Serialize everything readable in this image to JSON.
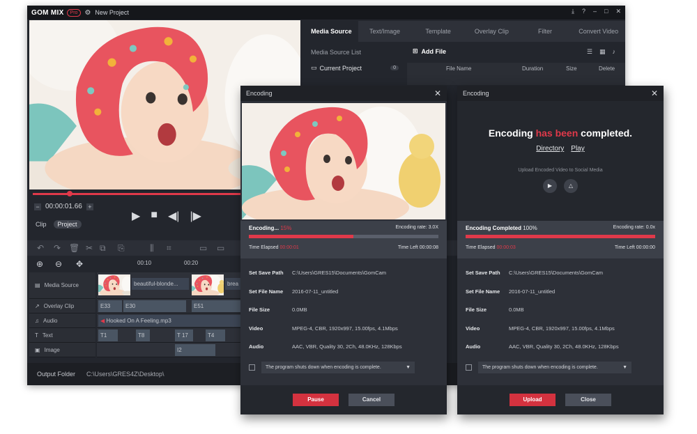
{
  "colors": {
    "accent": "#e0394a",
    "window_bg": "#23262d",
    "dialog_bg": "#2d3038"
  },
  "app": {
    "name": "GOM MIX",
    "badge": "Pro",
    "project_title": "New Project"
  },
  "window_controls": [
    "download-icon",
    "help-icon",
    "minimize-icon",
    "maximize-icon",
    "close-icon"
  ],
  "preview": {
    "timecode": "00:00:01.66",
    "minus": "−",
    "plus": "+",
    "clip_label": "Clip",
    "project_label": "Project"
  },
  "timeline": {
    "ruler": [
      "00:10",
      "00:20"
    ],
    "tracks": [
      "Media Source",
      "Overlay Clip",
      "Audio",
      "Text",
      "Image"
    ],
    "media_clip_1": "beautiful-blonde...",
    "media_clip_2": "brea",
    "overlay_items": [
      "E33",
      "E30",
      "E51"
    ],
    "audio_clip": "Hooked On A Feeling.mp3",
    "text_items": [
      "T1",
      "T8",
      "T 17",
      "T4"
    ],
    "image_item": "I2"
  },
  "footer": {
    "label": "Output Folder",
    "value": "C:\\Users\\GRES4Z\\Desktop\\"
  },
  "right_panel": {
    "tabs": [
      "Media Source",
      "Text/Image",
      "Template",
      "Overlay Clip",
      "Filter",
      "Convert Video"
    ],
    "side_list_title": "Media Source List",
    "current_project": "Current Project",
    "current_project_count": "0",
    "add_file": "Add File",
    "columns": [
      "File Name",
      "Duration",
      "Size",
      "Delete"
    ]
  },
  "dialog_encoding": {
    "title": "Encoding",
    "status": "Encoding...",
    "percent_text": "15%",
    "progress": 0.55,
    "rate": "Encoding rate: 3.0X",
    "elapsed_label": "Time Elapsed",
    "elapsed_value": "00:00:01",
    "left": "Time Left 00:00:08",
    "save_path_label": "Set Save Path",
    "save_path": "C:\\Users\\GRES15\\Documents\\GomCam",
    "file_name_label": "Set File Name",
    "file_name": "2016-07-11_untitled",
    "file_size_label": "File Size",
    "file_size": "0.0MB",
    "video_label": "Video",
    "video": "MPEG-4, CBR, 1920x997, 15.00fps, 4.1Mbps",
    "audio_label": "Audio",
    "audio": "AAC, VBR, Quality 30, 2Ch, 48.0KHz, 128Kbps",
    "shutdown_option": "The program shuts down when encoding is complete.",
    "pause": "Pause",
    "cancel": "Cancel"
  },
  "dialog_done": {
    "title": "Encoding",
    "headline_a": "Encoding",
    "headline_b": "has been",
    "headline_c": "completed.",
    "directory": "Directory",
    "play": "Play",
    "upload_caption": "Upload Encoded Video to Social Media",
    "status": "Encoding Completed",
    "percent_text": "100%",
    "progress": 1.0,
    "rate": "Encoding rate: 0.0x",
    "elapsed_label": "Time Elapsed",
    "elapsed_value": "00:00:03",
    "left": "Time Left 00:00:00",
    "save_path_label": "Set Save Path",
    "save_path": "C:\\Users\\GRES15\\Documents\\GomCam",
    "file_name_label": "Set File Name",
    "file_name": "2016-07-11_untitled",
    "file_size_label": "File Size",
    "file_size": "0.0MB",
    "video_label": "Video",
    "video": "MPEG-4, CBR, 1920x997, 15.00fps, 4.1Mbps",
    "audio_label": "Audio",
    "audio": "AAC, VBR, Quality 30, 2Ch, 48.0KHz, 128Kbps",
    "shutdown_option": "The program shuts down when encoding is complete.",
    "upload": "Upload",
    "close": "Close"
  }
}
